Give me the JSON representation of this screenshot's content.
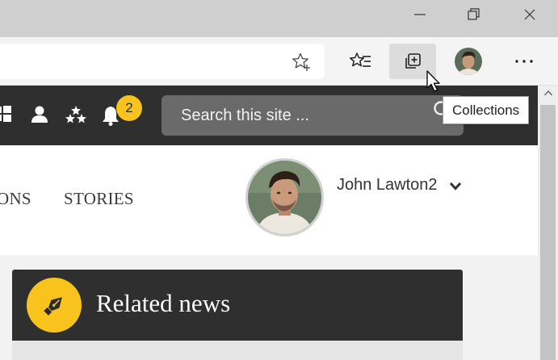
{
  "browser": {
    "window_controls": [
      "minimize-icon",
      "restore-icon",
      "close-icon"
    ],
    "toolbar": {
      "favorite_icon": "star-add-icon",
      "favorites_icon": "favorites-list-icon",
      "collections_icon": "collections-icon",
      "more_icon": "more-horizontal-icon"
    },
    "tooltip": "Collections"
  },
  "site": {
    "header_icons": [
      "windows-icon",
      "user-icon",
      "stars-icon",
      "bell-icon"
    ],
    "notification_count": "2",
    "search": {
      "placeholder": "Search this site ..."
    },
    "nav": [
      "ONS",
      "STORIES"
    ],
    "user": {
      "name": "John Lawton2"
    },
    "colors": {
      "dark_bar": "#2f2f2f",
      "accent": "#f7c31c"
    },
    "related": {
      "title": "Related news",
      "icon": "fountain-pen-icon"
    }
  }
}
